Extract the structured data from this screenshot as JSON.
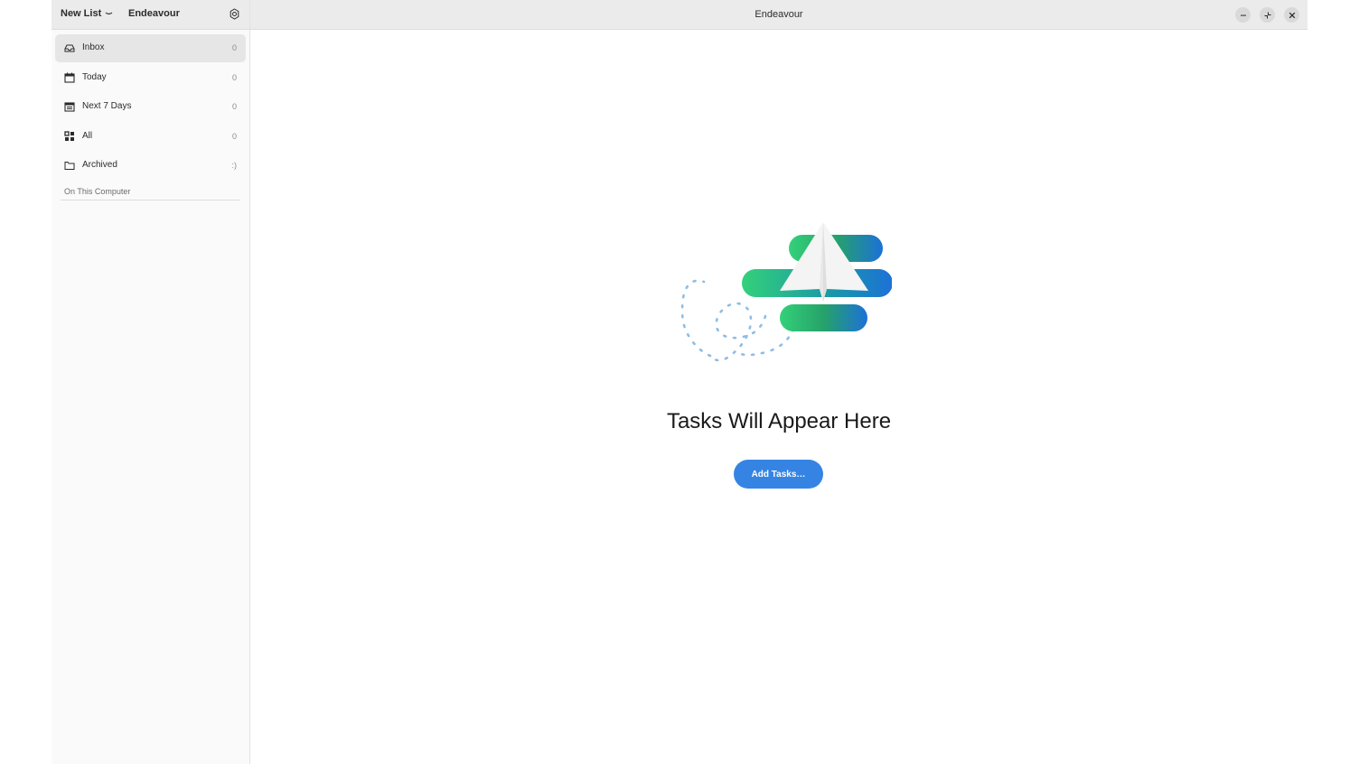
{
  "sidebar": {
    "new_list_label": "New List",
    "app_name": "Endeavour",
    "items": [
      {
        "label": "Inbox",
        "count": "0",
        "icon": "inbox-icon"
      },
      {
        "label": "Today",
        "count": "0",
        "icon": "calendar-icon"
      },
      {
        "label": "Next 7 Days",
        "count": "0",
        "icon": "calendar-week-icon"
      },
      {
        "label": "All",
        "count": "0",
        "icon": "grid-icon"
      },
      {
        "label": "Archived",
        "count": ":)",
        "icon": "folder-icon"
      }
    ],
    "section_title": "On This Computer"
  },
  "header": {
    "title": "Endeavour"
  },
  "main": {
    "empty_title": "Tasks Will Appear Here",
    "add_button_label": "Add Tasks…"
  },
  "colors": {
    "accent": "#3584e4",
    "active_item": "#e6e6e6"
  }
}
